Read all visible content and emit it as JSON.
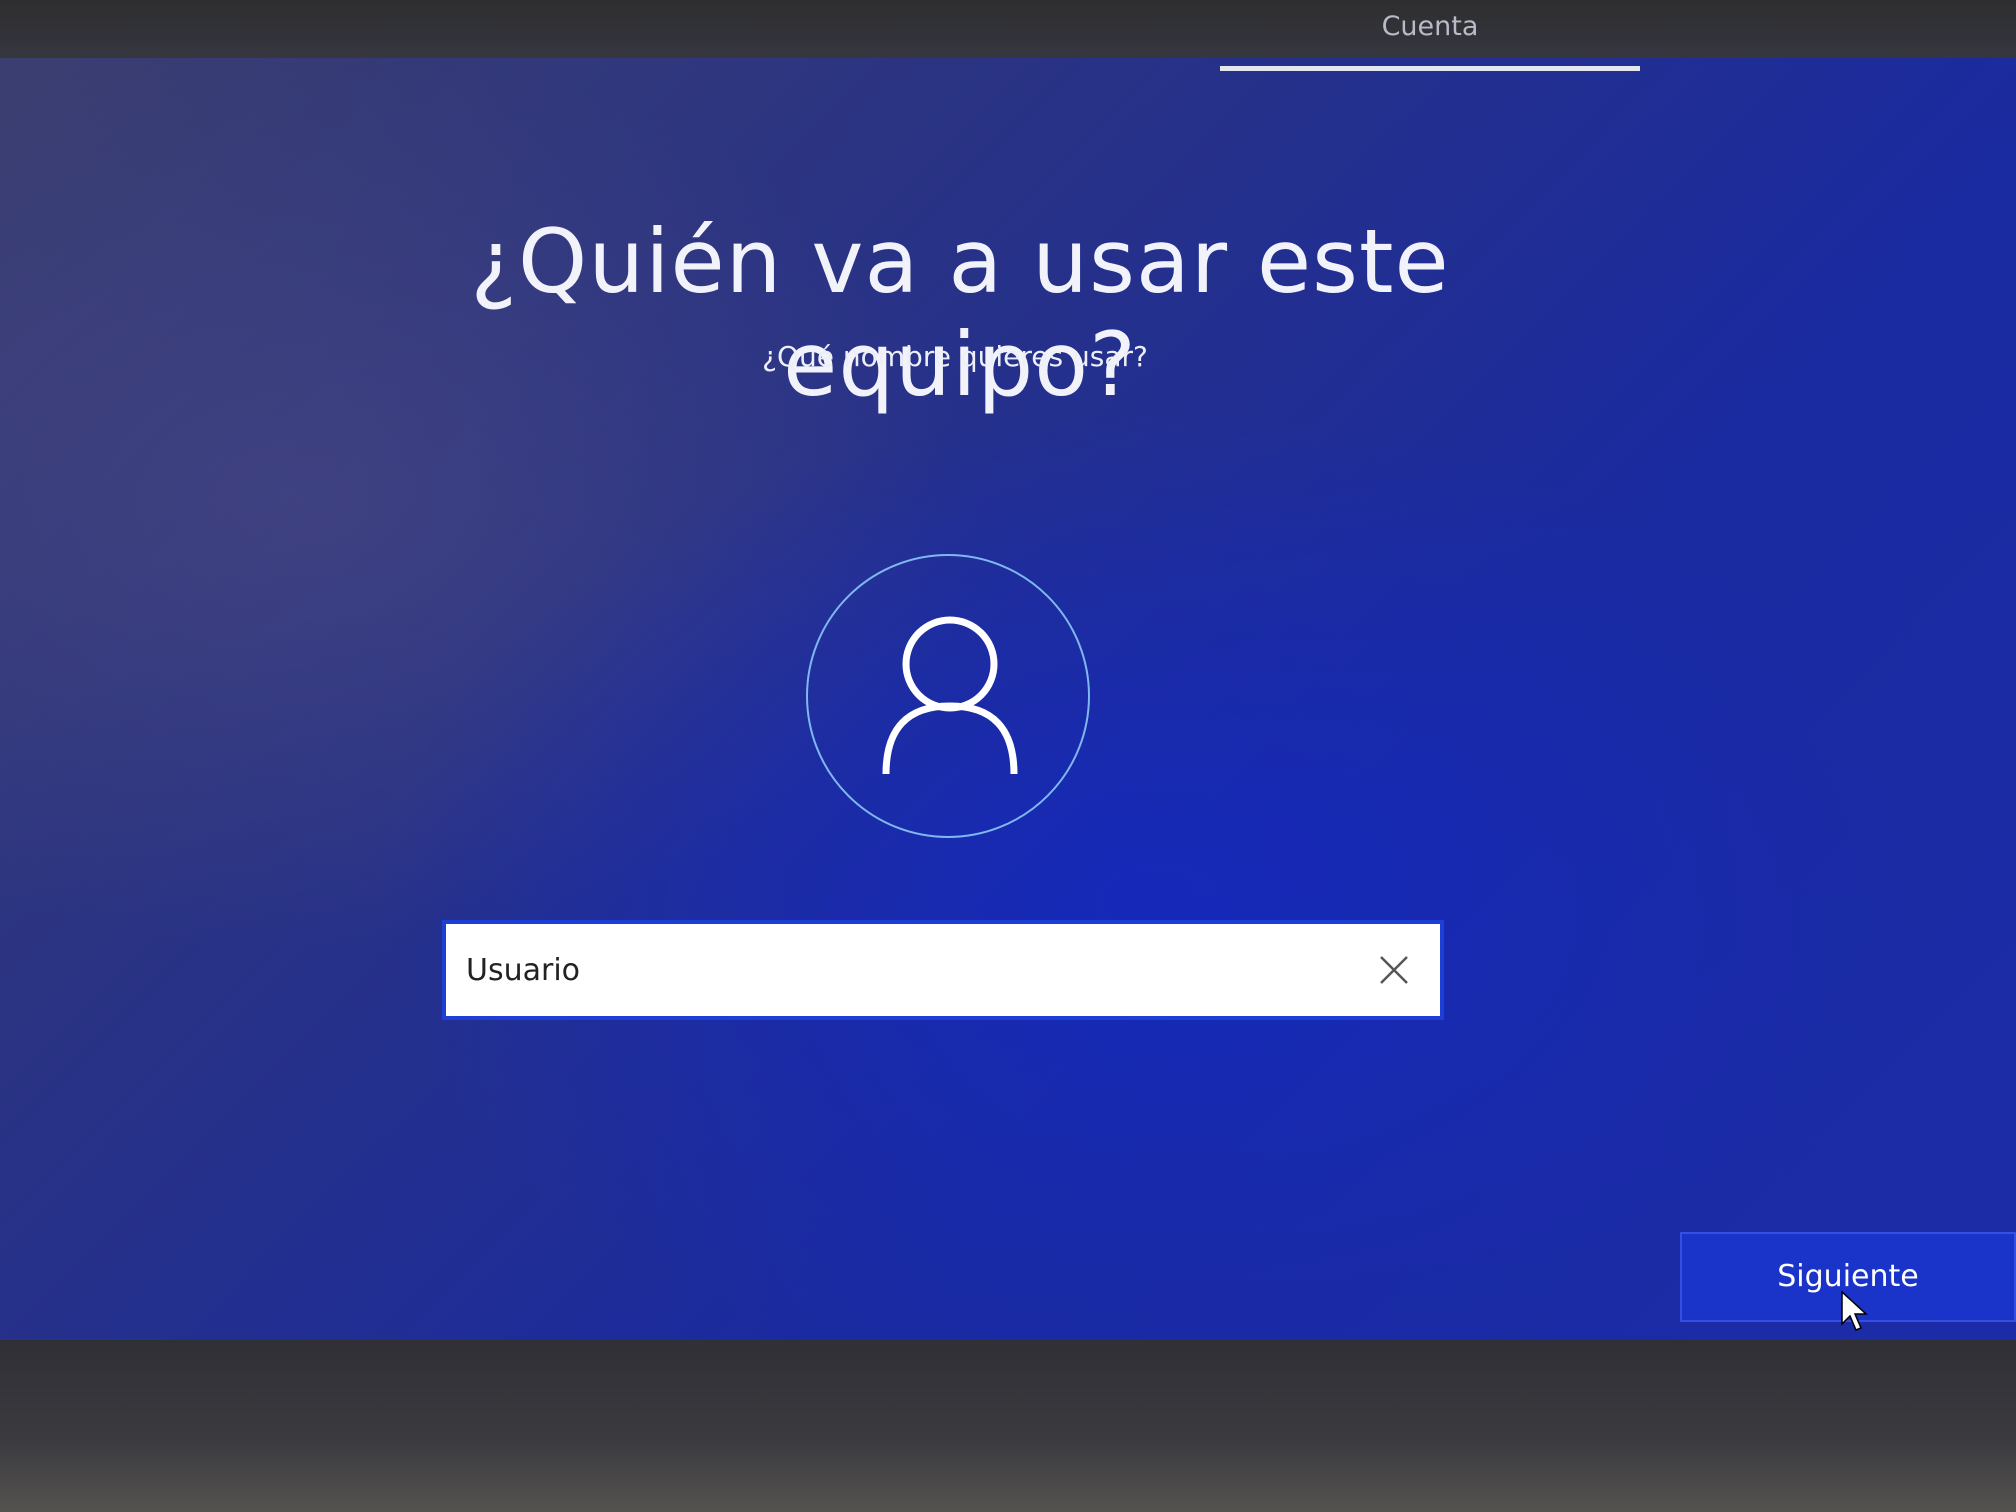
{
  "header": {
    "active_tab": "Cuenta"
  },
  "main": {
    "title": "¿Quién va a usar este equipo?",
    "subtitle": "¿Qué nombre quieres usar?",
    "avatar_icon": "user-icon",
    "name_input": {
      "value": "Usuario"
    },
    "clear_icon": "close-icon"
  },
  "footer": {
    "next_label": "Siguiente"
  },
  "colors": {
    "background": "#1f2ea0",
    "accent_ring": "#7fb7f0",
    "button": "#1a33c8",
    "input_border": "#1d3fd6"
  }
}
